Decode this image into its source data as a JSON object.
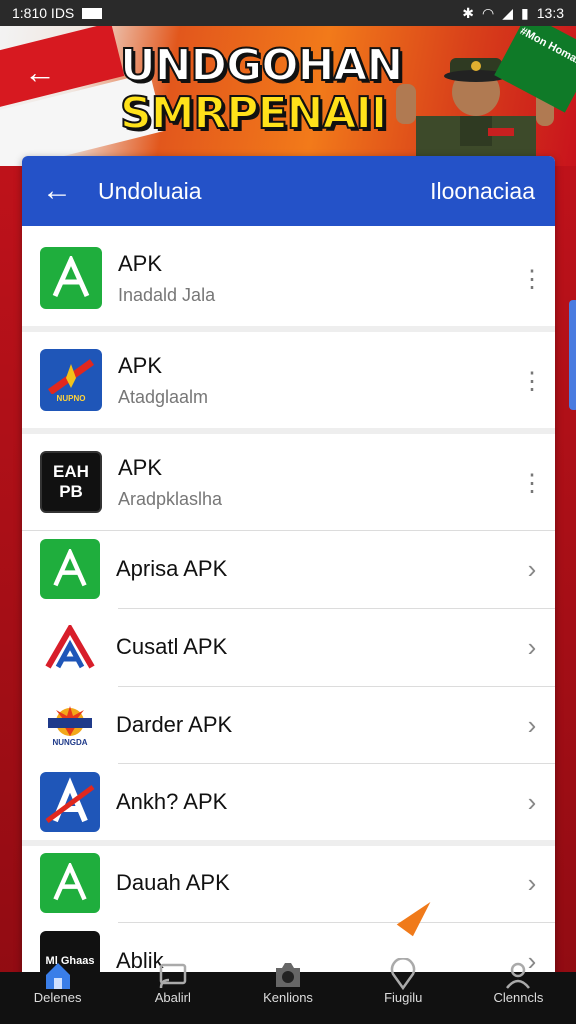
{
  "status_bar": {
    "time_left": "1:810 IDS",
    "time_right": "13:3"
  },
  "banner": {
    "line1": "UNDGOHAN",
    "line2": "SMRPENAII",
    "corner_tag": "#Mon Homana"
  },
  "appbar": {
    "title": "Undoluaia",
    "right_text": "Iloonaciaa"
  },
  "apps": [
    {
      "name": "APK",
      "subtitle": "Inadald Jala",
      "icon": "green-a-logo",
      "action": "more-vert"
    },
    {
      "name": "APK",
      "subtitle": "Atadglaalm",
      "icon": "blue-red-garuda-logo",
      "icon_text": "NUPNO",
      "action": "more-vert"
    },
    {
      "name": "APK",
      "subtitle": "Aradpklaslha",
      "icon": "black-pb-logo",
      "icon_text": "EAH PB",
      "action": "more-vert"
    },
    {
      "name": "Aprisa APK",
      "icon": "green-a-logo",
      "action": "chevron-right"
    },
    {
      "name": "Cusatl APK",
      "icon": "red-blue-a-logo",
      "action": "chevron-right"
    },
    {
      "name": "Darder APK",
      "icon": "sunburst-badge",
      "icon_text": "NUNGDA",
      "action": "chevron-right"
    },
    {
      "name": "Ankh? APK",
      "icon": "blue-red-a-logo",
      "action": "chevron-right"
    },
    {
      "name": "Dauah APK",
      "icon": "green-a-logo",
      "action": "chevron-right"
    },
    {
      "name": "Ablik",
      "icon": "black-text-logo",
      "icon_text": "Ml Ghaas",
      "action": "chevron-right"
    }
  ],
  "bottom_nav": [
    {
      "label": "Delenes",
      "icon": "home-icon"
    },
    {
      "label": "Abalirl",
      "icon": "cast-icon"
    },
    {
      "label": "Kenlions",
      "icon": "camera-icon"
    },
    {
      "label": "Fiugilu",
      "icon": "location-icon"
    },
    {
      "label": "Clenncls",
      "icon": "person-icon"
    }
  ],
  "colors": {
    "appbar": "#2452c8",
    "accent_green": "#1fae3d",
    "background_red": "#c8131c",
    "cursor": "#f07a1a"
  }
}
